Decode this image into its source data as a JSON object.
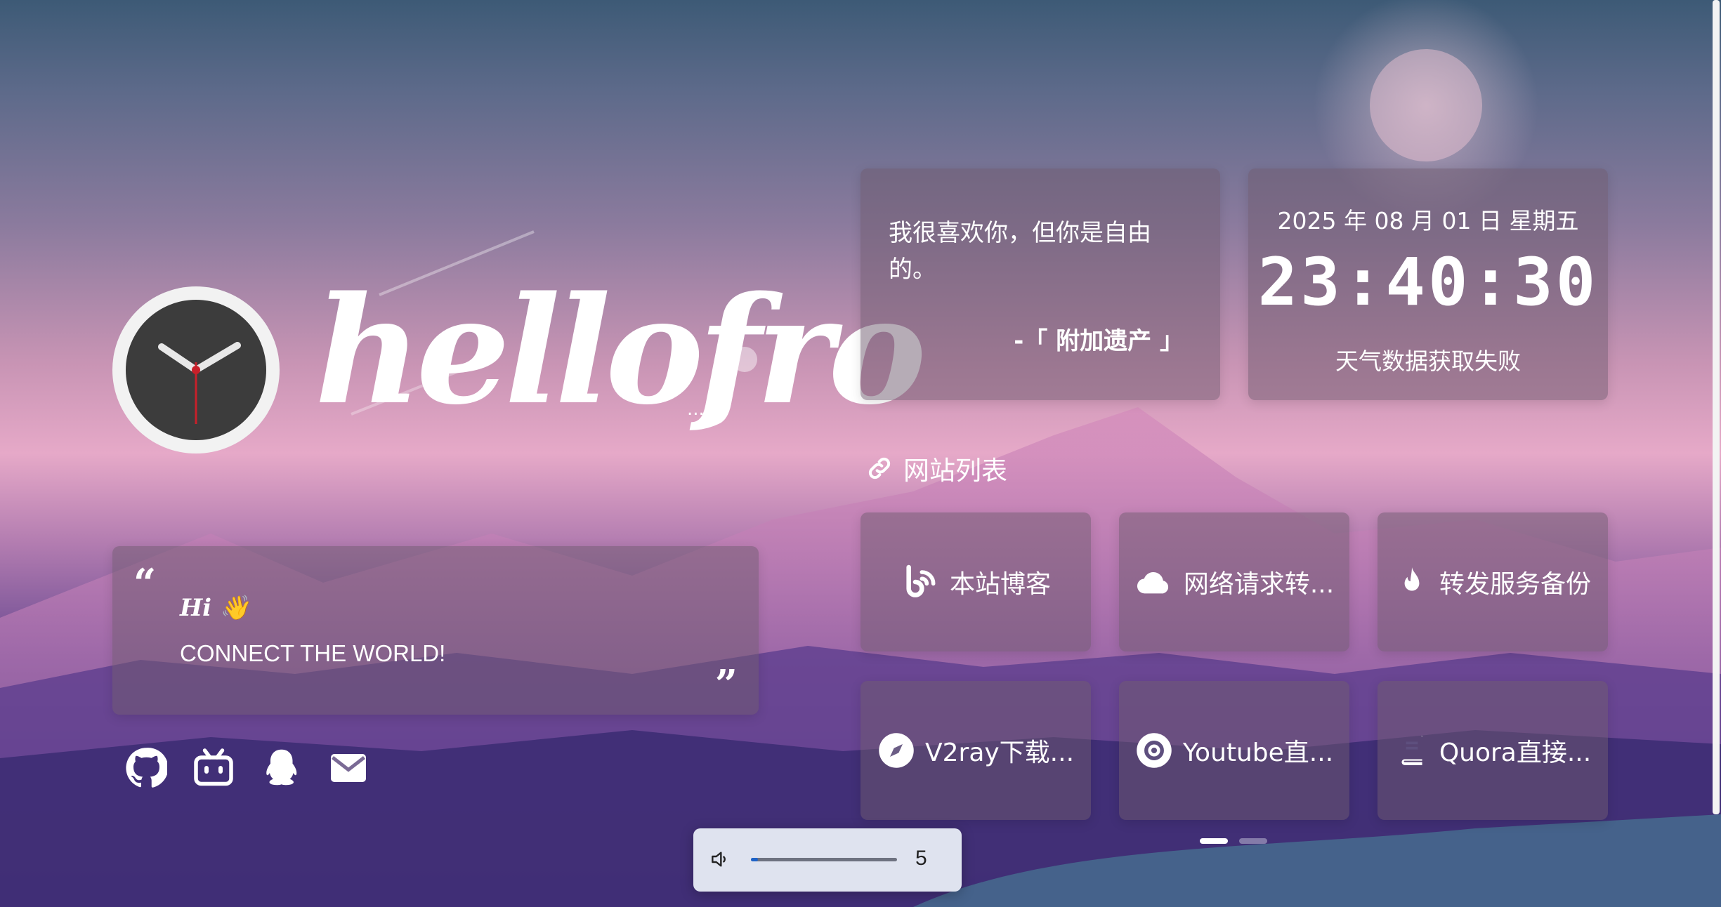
{
  "logo": {
    "icon": "clock-icon",
    "text": "hellofro",
    "suffix": "..."
  },
  "intro": {
    "greeting": "Hi 👋",
    "description": "CONNECT THE WORLD!"
  },
  "socials": [
    {
      "name": "github-icon"
    },
    {
      "name": "bilibili-icon"
    },
    {
      "name": "qq-icon"
    },
    {
      "name": "email-icon"
    }
  ],
  "hitokoto": {
    "text": "我很喜欢你，但你是自由的。",
    "from": "-「 附加遗产 」"
  },
  "time": {
    "date": "2025 年 08 月 01 日 星期五",
    "clock": "23:40:30",
    "weather": "天气数据获取失败"
  },
  "site_list": {
    "title": "网站列表",
    "items": [
      {
        "label": "本站博客",
        "icon": "blog-icon"
      },
      {
        "label": "网络请求转...",
        "icon": "cloud-icon"
      },
      {
        "label": "转发服务备份",
        "icon": "fire-icon"
      },
      {
        "label": "V2ray下载...",
        "icon": "compass-icon"
      },
      {
        "label": "Youtube直...",
        "icon": "disc-icon"
      },
      {
        "label": "Quora直接...",
        "icon": "book-icon"
      }
    ],
    "pages": 2,
    "active_page": 1
  },
  "volume": {
    "value": "5",
    "level": 0.05
  },
  "colors": {
    "accent": "#1e63c8",
    "card": "rgba(110,90,110,0.5)"
  }
}
